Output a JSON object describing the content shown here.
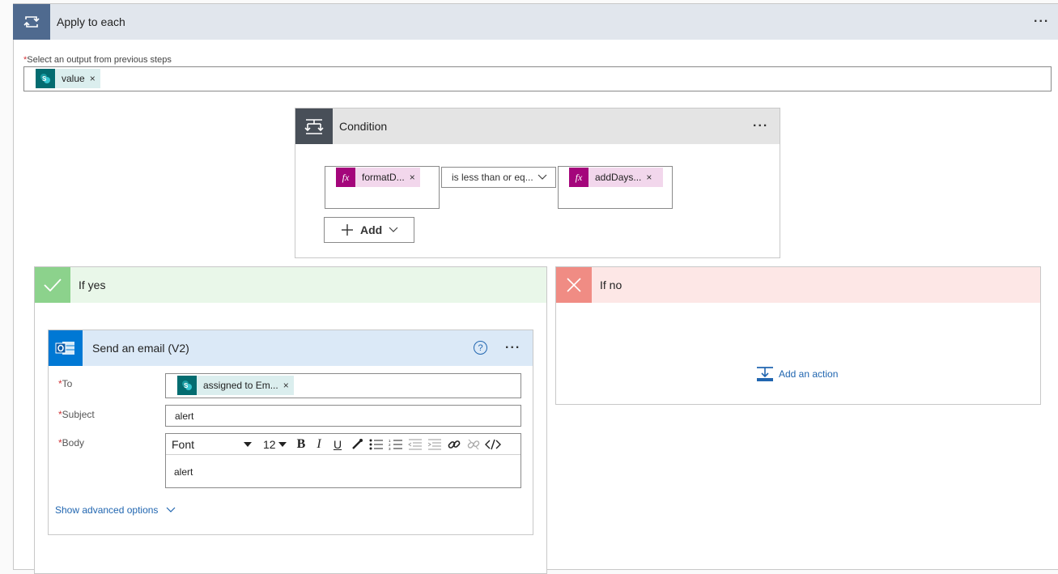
{
  "apply_to_each": {
    "title": "Apply to each",
    "output_label": "Select an output from previous steps",
    "output_token": "value",
    "more_label": "..."
  },
  "condition": {
    "title": "Condition",
    "left_token": "formatD...",
    "operator": "is less than or eq...",
    "right_token": "addDays...",
    "add_label": "Add",
    "more_label": "..."
  },
  "if_yes": {
    "title": "If yes"
  },
  "if_no": {
    "title": "If no",
    "add_action_label": "Add an action"
  },
  "send_email": {
    "title": "Send an email (V2)",
    "more_label": "...",
    "help_label": "?",
    "to_label": "To",
    "to_token": "assigned to Em...",
    "subject_label": "Subject",
    "subject_value": "alert",
    "body_label": "Body",
    "font_value": "Font",
    "font_size_value": "12",
    "body_value": "alert",
    "show_advanced": "Show advanced options"
  },
  "token_x": "×",
  "required_mark": "*",
  "colors": {
    "loop_header": "#4f6a8f",
    "condition_header": "#484f58",
    "yes_green": "#8cd28c",
    "no_red": "#f08c84",
    "fx_purple": "#a4057b",
    "fx_bg": "#f2d7ec",
    "sp_teal": "#036c70",
    "outlook_blue": "#0078d4",
    "link_blue": "#2166b0"
  }
}
